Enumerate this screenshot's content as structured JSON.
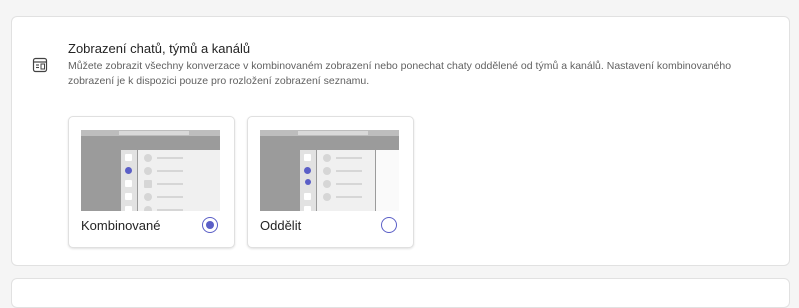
{
  "section": {
    "icon": "chat-layout-icon",
    "title": "Zobrazení chatů, týmů a kanálů",
    "description": "Můžete zobrazit všechny konverzace v kombinovaném zobrazení nebo ponechat chaty oddělené od týmů a kanálů. Nastavení kombinovaného zobrazení je k dispozici pouze pro rozložení zobrazení seznamu."
  },
  "options": [
    {
      "label": "Kombinované",
      "selected": true
    },
    {
      "label": "Oddělit",
      "selected": false
    }
  ],
  "colors": {
    "accent": "#5b5fc7",
    "card_border": "#e1e1e1",
    "page_background": "#f5f5f5"
  }
}
